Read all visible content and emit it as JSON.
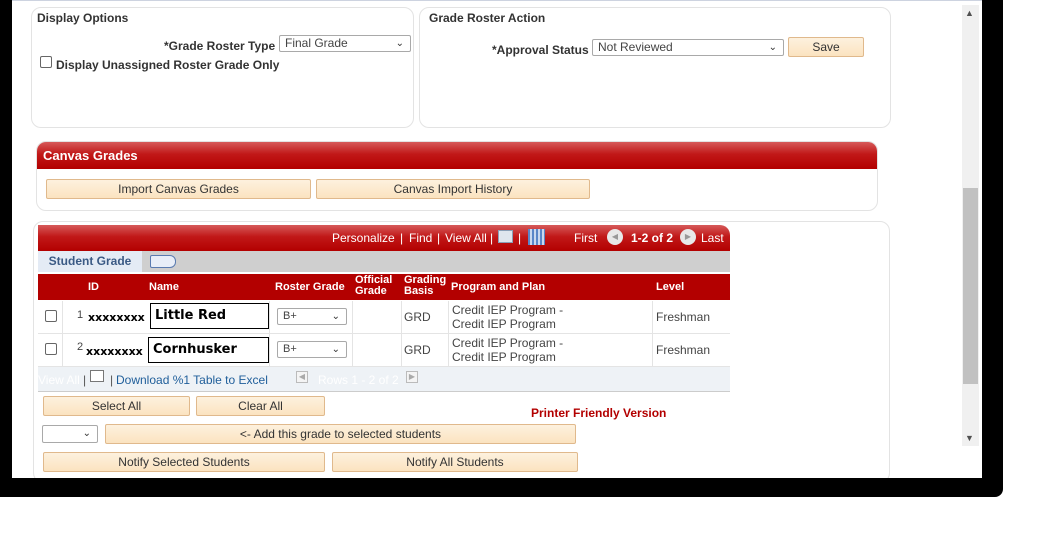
{
  "display_options": {
    "title": "Display Options",
    "roster_type_label": "*Grade Roster Type",
    "roster_type_value": "Final Grade",
    "unassigned_label": "Display Unassigned Roster Grade Only",
    "unassigned_checked": false
  },
  "roster_action": {
    "title": "Grade Roster Action",
    "approval_label": "*Approval Status",
    "approval_value": "Not Reviewed",
    "save_label": "Save"
  },
  "canvas": {
    "title": "Canvas Grades",
    "import_label": "Import Canvas Grades",
    "history_label": "Canvas Import History"
  },
  "grid": {
    "nav": {
      "personalize": "Personalize",
      "find": "Find",
      "view_all": "View All",
      "first": "First",
      "range": "1-2 of 2",
      "last": "Last",
      "sep": "|"
    },
    "tab": "Student Grade",
    "columns": {
      "id": "ID",
      "name": "Name",
      "roster_grade": "Roster Grade",
      "official_grade_1": "Official",
      "official_grade_2": "Grade",
      "grading_basis_1": "Grading",
      "grading_basis_2": "Basis",
      "program": "Program and Plan",
      "level": "Level"
    },
    "rows": [
      {
        "num": "1",
        "id": "xxxxxxxx",
        "name": "Little Red",
        "roster_grade": "B+",
        "official_grade": "",
        "basis": "GRD",
        "program_1": "Credit IEP Program -",
        "program_2": "Credit IEP Program",
        "level": "Freshman"
      },
      {
        "num": "2",
        "id": "xxxxxxxx",
        "name": "Cornhusker",
        "roster_grade": "B+",
        "official_grade": "",
        "basis": "GRD",
        "program_1": "Credit IEP Program -",
        "program_2": "Credit IEP Program",
        "level": "Freshman"
      }
    ],
    "footer": {
      "view_all": "View All",
      "download": "Download %1 Table to Excel",
      "rows": "Rows 1 - 2 of 2"
    }
  },
  "actions": {
    "select_all": "Select All",
    "clear_all": "Clear All",
    "printer_friendly": "Printer Friendly Version",
    "grade_select_value": "",
    "add_grade": "<- Add this grade to selected students",
    "notify_selected": "Notify Selected Students",
    "notify_all": "Notify All Students"
  },
  "colors": {
    "brand_red": "#b30000",
    "button_fill": "#fbe3c0",
    "link_blue": "#1f5e9a"
  }
}
